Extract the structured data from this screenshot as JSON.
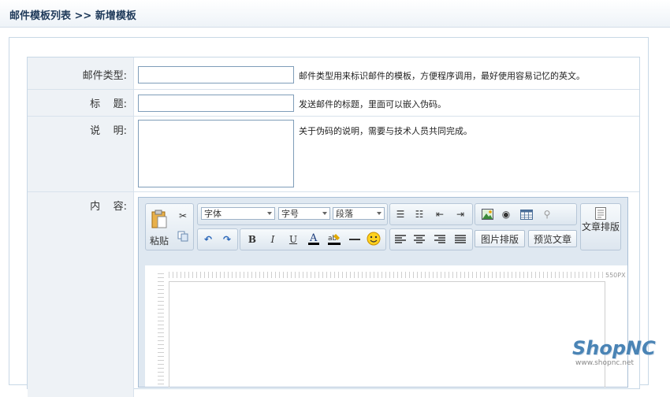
{
  "header": {
    "breadcrumb": "邮件模板列表 >> 新增模板"
  },
  "form": {
    "mail_type": {
      "label": "邮件类型:",
      "value": "",
      "hint": "邮件类型用来标识邮件的模板，方便程序调用，最好使用容易记忆的英文。"
    },
    "subject": {
      "label": "标    题:",
      "value": "",
      "hint": "发送邮件的标题，里面可以嵌入伪码。"
    },
    "description": {
      "label": "说    明:",
      "value": "",
      "hint": "关于伪码的说明，需要与技术人员共同完成。"
    },
    "content": {
      "label": "内    容:"
    }
  },
  "editor": {
    "paste_label": "粘贴",
    "font_select": "字体",
    "size_select": "字号",
    "paragraph_select": "段落",
    "image_layout_button": "图片排版",
    "preview_button": "预览文章",
    "article_layout_button": "文章排版",
    "ruler_width": "550PX"
  },
  "brand": {
    "name": "ShopNC",
    "url": "www.shopnc.net"
  }
}
